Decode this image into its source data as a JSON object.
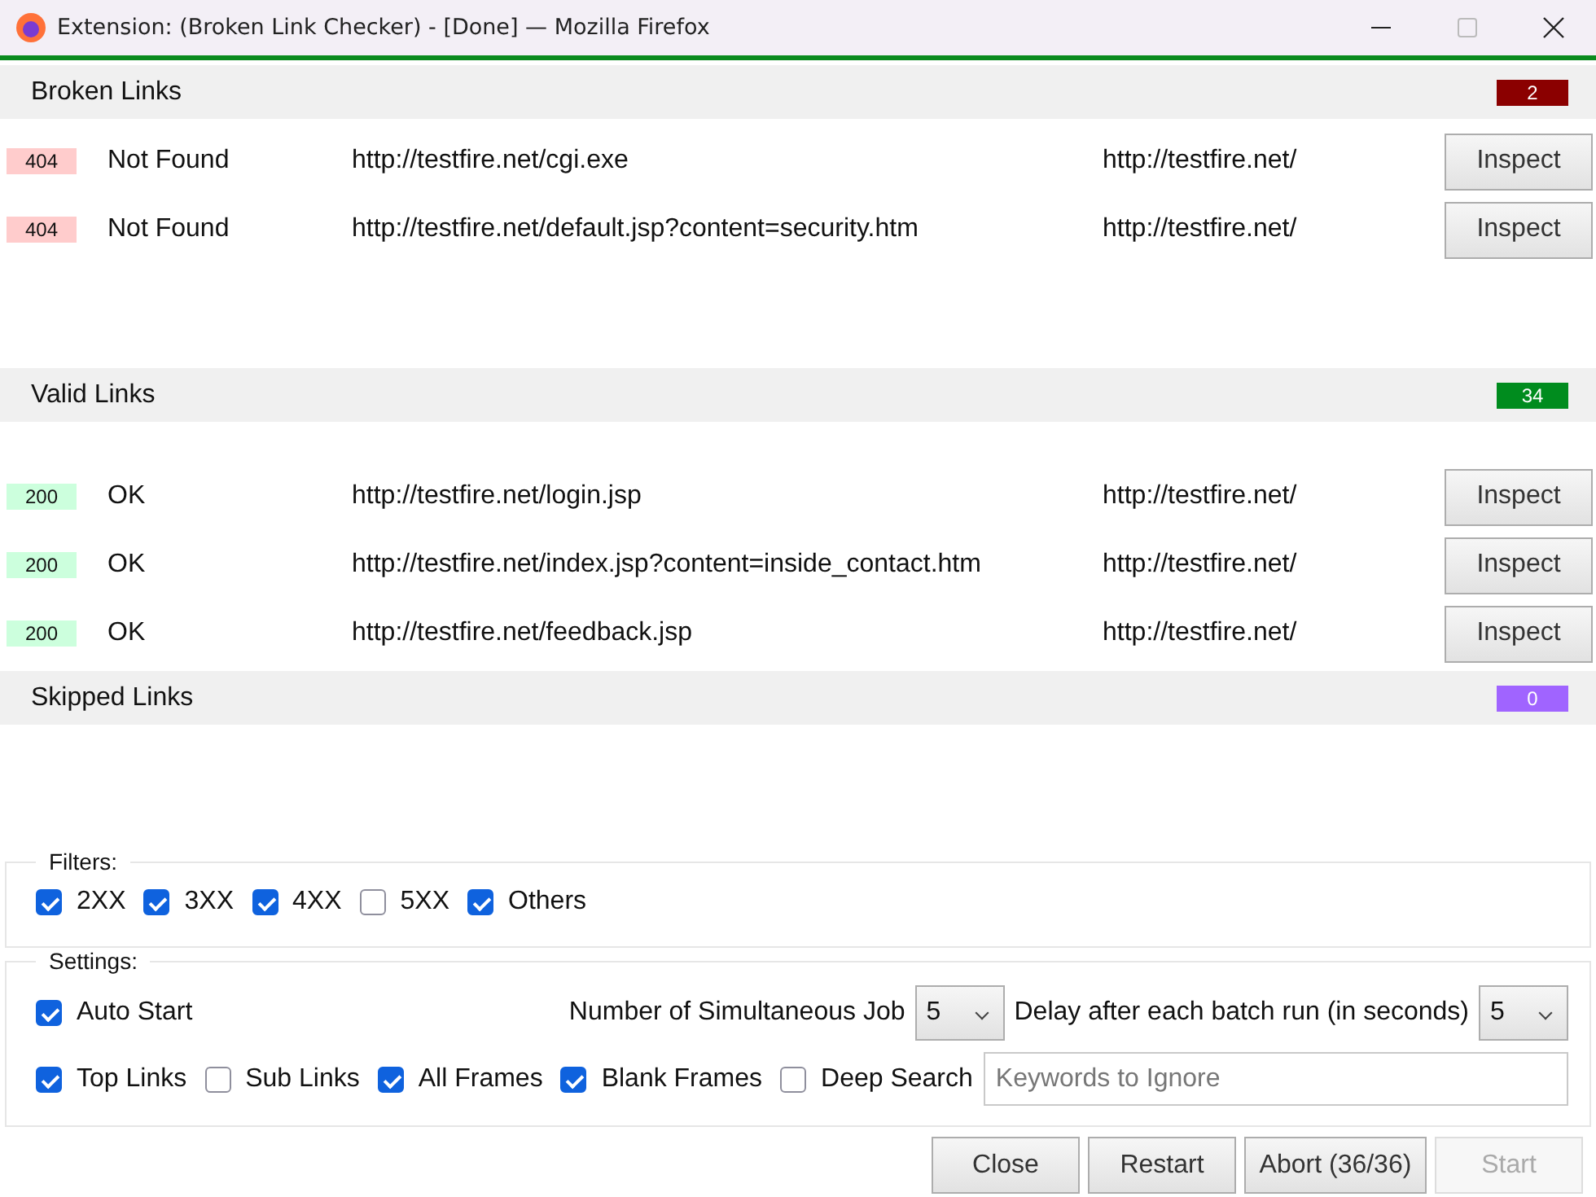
{
  "window": {
    "title": "Extension: (Broken Link Checker) - [Done] — Mozilla Firefox"
  },
  "sections": [
    {
      "title": "Broken Links",
      "count": "2",
      "color": "#8b0000",
      "rows": [
        {
          "code": "404",
          "color": "#ffcccc",
          "status": "Not Found",
          "url": "http://testfire.net/cgi.exe",
          "parent": "http://testfire.net/",
          "action": "Inspect"
        },
        {
          "code": "404",
          "color": "#ffcccc",
          "status": "Not Found",
          "url": "http://testfire.net/default.jsp?content=security.htm",
          "parent": "http://testfire.net/",
          "action": "Inspect"
        }
      ]
    },
    {
      "title": "Valid Links",
      "count": "34",
      "color": "#008c1e",
      "rows": [
        {
          "code": "200",
          "color": "#ccffdd",
          "status": "OK",
          "url": "http://testfire.net/login.jsp",
          "parent": "http://testfire.net/",
          "action": "Inspect"
        },
        {
          "code": "200",
          "color": "#ccffdd",
          "status": "OK",
          "url": "http://testfire.net/index.jsp?content=inside_contact.htm",
          "parent": "http://testfire.net/",
          "action": "Inspect"
        },
        {
          "code": "200",
          "color": "#ccffdd",
          "status": "OK",
          "url": "http://testfire.net/feedback.jsp",
          "parent": "http://testfire.net/",
          "action": "Inspect"
        }
      ]
    },
    {
      "title": "Skipped Links",
      "count": "0",
      "color": "#a064ff"
    }
  ],
  "filters": {
    "legend": "Filters:",
    "items": [
      {
        "label": "2XX",
        "checked": true
      },
      {
        "label": "3XX",
        "checked": true
      },
      {
        "label": "4XX",
        "checked": true
      },
      {
        "label": "5XX",
        "checked": false
      },
      {
        "label": "Others",
        "checked": true
      }
    ]
  },
  "settings": {
    "legend": "Settings:",
    "auto_start": {
      "label": "Auto Start",
      "checked": true
    },
    "jobs": {
      "label": "Number of Simultaneous Job",
      "value": "5"
    },
    "delay": {
      "label": "Delay after each batch run (in seconds)",
      "value": "5"
    },
    "options": [
      {
        "label": "Top Links",
        "checked": true
      },
      {
        "label": "Sub Links",
        "checked": false
      },
      {
        "label": "All Frames",
        "checked": true
      },
      {
        "label": "Blank Frames",
        "checked": true
      },
      {
        "label": "Deep Search",
        "checked": false
      }
    ],
    "keywords": {
      "placeholder": "Keywords to Ignore"
    }
  },
  "buttons": [
    {
      "label": "Close",
      "disabled": false
    },
    {
      "label": "Restart",
      "disabled": false
    },
    {
      "label": "Abort (36/36)",
      "disabled": false
    },
    {
      "label": "Start",
      "disabled": true
    }
  ]
}
